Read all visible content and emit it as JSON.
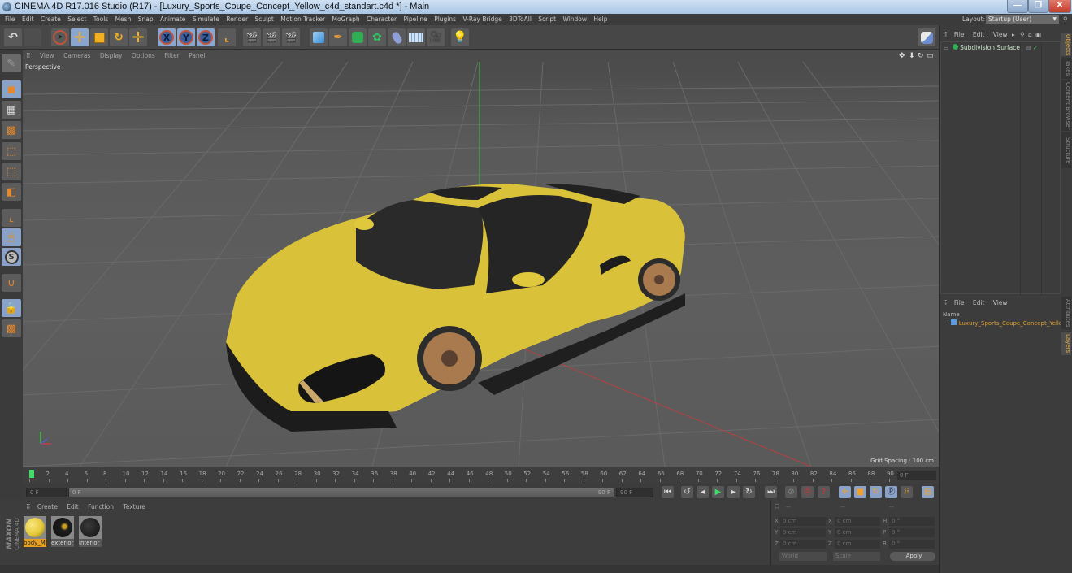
{
  "window": {
    "title": "CINEMA 4D R17.016 Studio (R17) - [Luxury_Sports_Coupe_Concept_Yellow_c4d_standart.c4d *] - Main",
    "minimize_label": "—",
    "restore_label": "❐",
    "close_label": "✕"
  },
  "menubar": {
    "items": [
      "File",
      "Edit",
      "Create",
      "Select",
      "Tools",
      "Mesh",
      "Snap",
      "Animate",
      "Simulate",
      "Render",
      "Sculpt",
      "Motion Tracker",
      "MoGraph",
      "Character",
      "Pipeline",
      "Plugins",
      "V-Ray Bridge",
      "3DToAll",
      "Script",
      "Window",
      "Help"
    ],
    "layout_label": "Layout:",
    "layout_value": "Startup (User)"
  },
  "toolbar": {
    "undo_icon": "↶",
    "axis_x": "X",
    "axis_y": "Y",
    "axis_z": "Z"
  },
  "viewport": {
    "menu": [
      "View",
      "Cameras",
      "Display",
      "Options",
      "Filter",
      "Panel"
    ],
    "camera_label": "Perspective",
    "grid_spacing": "Grid Spacing : 100 cm",
    "accent_yellow": "#e8cf3a"
  },
  "timeline": {
    "ticks": [
      "0",
      "2",
      "4",
      "6",
      "8",
      "10",
      "12",
      "14",
      "16",
      "18",
      "20",
      "22",
      "24",
      "26",
      "28",
      "30",
      "32",
      "34",
      "36",
      "38",
      "40",
      "42",
      "44",
      "46",
      "48",
      "50",
      "52",
      "54",
      "56",
      "58",
      "60",
      "62",
      "64",
      "66",
      "68",
      "70",
      "72",
      "74",
      "76",
      "78",
      "80",
      "82",
      "84",
      "86",
      "88",
      "90"
    ],
    "current_frame_display": "0 F",
    "start_frame": "0 F",
    "slider_start": "0 F",
    "slider_end": "90 F",
    "end_frame": "90 F"
  },
  "materials": {
    "menu": [
      "Create",
      "Edit",
      "Function",
      "Texture"
    ],
    "items": [
      {
        "name": "body_M",
        "selected": true,
        "color": "#e6c93a"
      },
      {
        "name": "exterior",
        "selected": false,
        "color": "#1e1e1e"
      },
      {
        "name": "interior",
        "selected": false,
        "color": "#222222"
      }
    ],
    "brand_top": "MAXON",
    "brand_bottom": "CINEMA 4D"
  },
  "coordinates": {
    "header": [
      "--",
      "--",
      "--"
    ],
    "rows": [
      {
        "a_label": "X",
        "a_val": "0 cm",
        "b_label": "X",
        "b_val": "0 cm",
        "c_label": "H",
        "c_val": "0 °"
      },
      {
        "a_label": "Y",
        "a_val": "0 cm",
        "b_label": "Y",
        "b_val": "0 cm",
        "c_label": "P",
        "c_val": "0 °"
      },
      {
        "a_label": "Z",
        "a_val": "0 cm",
        "b_label": "Z",
        "b_val": "0 cm",
        "c_label": "B",
        "c_val": "0 °"
      }
    ],
    "mode_select": "World",
    "type_select": "Scale",
    "apply_label": "Apply"
  },
  "objects_panel": {
    "menu": [
      "File",
      "Edit",
      "View"
    ],
    "items": [
      {
        "name": "Subdivision Surface"
      }
    ]
  },
  "layers_panel": {
    "menu": [
      "File",
      "Edit",
      "View"
    ],
    "column_header": "Name",
    "items": [
      {
        "name": "Luxury_Sports_Coupe_Concept_Yellow"
      }
    ]
  },
  "side_tabs": {
    "top": [
      "Objects",
      "Takes",
      "Content Browser",
      "Structure"
    ],
    "bottom": [
      "Attributes",
      "Layers"
    ]
  }
}
